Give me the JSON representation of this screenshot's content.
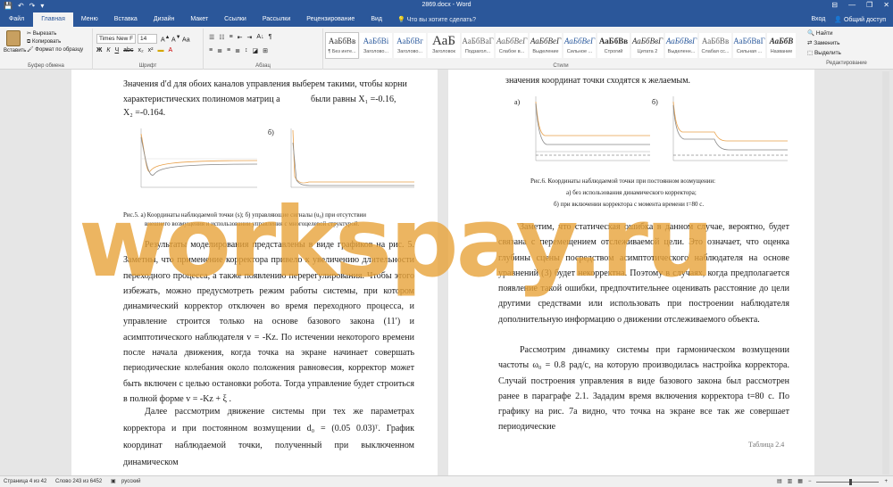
{
  "window": {
    "title": "2869.docx - Word",
    "qa": [
      "💾",
      "↶",
      "↷",
      "▾"
    ],
    "min": "—",
    "max": "❐",
    "close": "✕",
    "ribbon_toggle": "⊟"
  },
  "tabs": [
    "Файл",
    "Главная",
    "Меню",
    "Вставка",
    "Дизайн",
    "Макет",
    "Ссылки",
    "Рассылки",
    "Рецензирование",
    "Вид"
  ],
  "tell_me": "Что вы хотите сделать?",
  "signin": "Вход",
  "share": "Общий доступ",
  "clipboard": {
    "paste": "Вставить",
    "cut": "Вырезать",
    "copy": "Копировать",
    "format_painter": "Формат по образцу",
    "label": "Буфер обмена"
  },
  "font": {
    "name": "Times New F",
    "size": "14",
    "bold": "Ж",
    "italic": "К",
    "underline": "Ч",
    "strike": "abc",
    "sub": "x₂",
    "sup": "x²",
    "label": "Шрифт"
  },
  "paragraph": {
    "label": "Абзац",
    "row1": [
      "☰",
      "☷",
      "≡",
      "⇤",
      "⇥",
      "A↓",
      "¶"
    ],
    "row2": [
      "≡",
      "≣",
      "≡",
      "≣",
      "↕",
      "◪",
      "⊞"
    ]
  },
  "styles": {
    "label": "Стили",
    "items": [
      {
        "sample": "АаБбВв",
        "name": "¶ Без инте..."
      },
      {
        "sample": "АаБбВі",
        "name": "Заголово..."
      },
      {
        "sample": "АаБбВг",
        "name": "Заголово..."
      },
      {
        "sample": "АаБ",
        "name": "Заголовок"
      },
      {
        "sample": "АаБбВаГ",
        "name": "Подзагол..."
      },
      {
        "sample": "АаБбВеГ",
        "name": "Слабое в..."
      },
      {
        "sample": "АаБбВеГ",
        "name": "Выделение"
      },
      {
        "sample": "АаБбВеГ",
        "name": "Сильное ..."
      },
      {
        "sample": "АаБбВв",
        "name": "Строгий"
      },
      {
        "sample": "АаБбВвГ",
        "name": "Цитата 2"
      },
      {
        "sample": "АаБбВвГ",
        "name": "Выделенн..."
      },
      {
        "sample": "АаБбВв",
        "name": "Слабая сс..."
      },
      {
        "sample": "АаБбВвГ",
        "name": "Сильная ..."
      },
      {
        "sample": "АаБбВ",
        "name": "Название"
      }
    ]
  },
  "editing": {
    "find": "Найти",
    "replace": "Заменить",
    "select": "Выделить",
    "label": "Редактирование"
  },
  "page1": {
    "intro": "Значения d′d для обоих каналов управления выберем такими, чтобы корни",
    "intro2": "характеристических полиномов матриц a",
    "intro3": "были равны X₁ =-0.16,",
    "intro4": "X₂ =-0.164.",
    "fig_b": "б)",
    "caption1": "Рис.5. а) Координаты наблюдаемой точки (s); б) управляющие сигналы (u₀) при отсутствии",
    "caption2": "внешнего возмущения и использовании управления с многоцелевой структурой.",
    "para1": "Результаты моделирования представлены в виде графиков на рис. 5. Заметны, что применение корректора привело к увеличению длительности переходного процесса, а также появлению перерегулирования. Чтобы этого избежать, можно предусмотреть режим работы системы, при котором динамический корректор отключен во время переходного процесса, и управление строится только на основе базового закона (11′) и асимптотического наблюдателя v = -Kz. По истечении некоторого времени после начала движения, когда точка на экране начинает совершать периодические колебания около положения равновесия, корректор может быть включен с целью остановки робота. Тогда управление будет строиться в полной форме v = -Kz + ξ .",
    "para2": "Далее рассмотрим движение системы при тех же параметрах корректора и при постоянном возмущении d₀ = (0.05  0.03)ᵀ. График координат наблюдаемой точки, полученный при выключенном динамическом"
  },
  "page2": {
    "top": "значения координат точки сходятся к желаемым.",
    "fig_a": "а)",
    "fig_b": "б)",
    "caption1": "Рис.6. Координаты наблюдаемой точки при постоянном возмущении:",
    "caption2": "а) без использования динамического корректора;",
    "caption3": "б) при включении корректора с момента времени t=80 с.",
    "para1": "Заметим, что статическая ошибка в данном случае, вероятно, будет связана с перемещением отслеживаемой цели. Это означает, что оценка глубины сцены посредством асимптотического наблюдателя на основе уравнений (3) будет некорректна. Поэтому в случаях, когда предполагается появление такой ошибки, предпочтительнее оценивать расстояние до цели другими средствами или использовать при построении наблюдателя дополнительную информацию о движении отслеживаемого объекта.",
    "para2": "Рассмотрим динамику системы при гармоническом возмущении частоты ω₀ = 0.8 рад/с, на которую производилась настройка корректора. Случай построения управления в виде базового закона был рассмотрен ранее в параграфе 2.1. Зададим время включения корректора t=80 с. По графику на рис. 7а видно, что точка на экране все так же совершает периодические",
    "table_label": "Таблица 2.4"
  },
  "watermark": "workspay.ru",
  "status": {
    "page": "Страница 4 из 42",
    "words": "Слово 243 из 6452",
    "lang": "русский",
    "zoom": "+",
    "zoom_out": "−",
    "zoom_fraction": 0.55
  }
}
